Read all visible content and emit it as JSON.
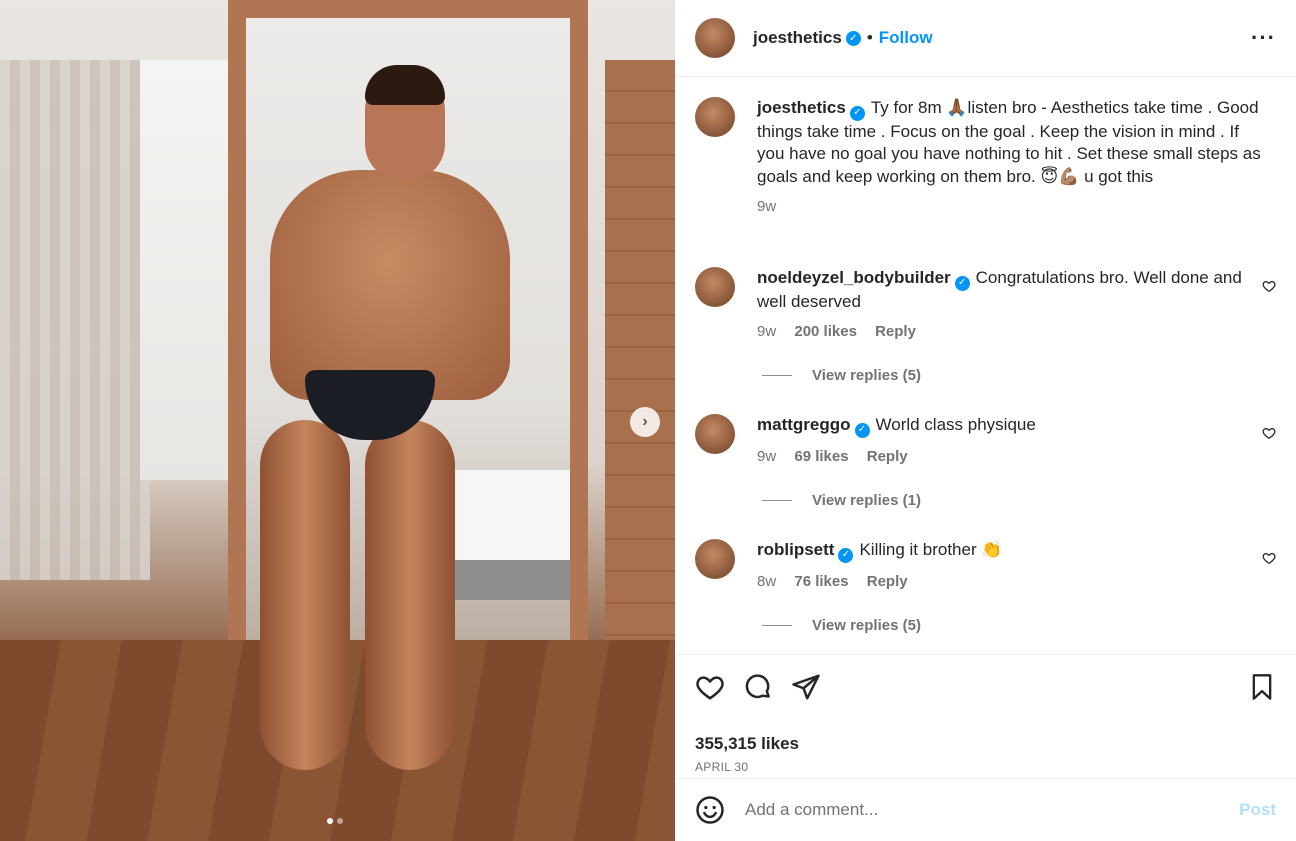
{
  "media": {
    "carousel_next_icon": "chevron-right-icon",
    "dots": [
      true,
      false
    ]
  },
  "post": {
    "username": "joesthetics",
    "follow_label": "Follow",
    "more_icon": "more-horizontal-icon",
    "caption_text": "Ty for 8m 🙏🏾listen bro - Aesthetics take time . Good things take time . Focus on the goal . Keep the vision in mind . If you have no goal you have nothing to hit . Set these small steps as goals and keep working on them bro. 😇💪🏽 u got this",
    "caption_time": "9w",
    "likes": "355,315 likes",
    "date": "APRIL 30",
    "comment_placeholder": "Add a comment...",
    "post_label": "Post"
  },
  "comments": [
    {
      "username": "noeldeyzel_bodybuilder",
      "text": "Congratulations bro. Well done and well deserved",
      "time": "9w",
      "likes": "200 likes",
      "reply": "Reply",
      "view_replies": "View replies (5)"
    },
    {
      "username": "mattgreggo",
      "text": "World class physique",
      "time": "9w",
      "likes": "69 likes",
      "reply": "Reply",
      "view_replies": "View replies (1)"
    },
    {
      "username": "roblipsett",
      "text": "Killing it brother 👏",
      "time": "8w",
      "likes": "76 likes",
      "reply": "Reply",
      "view_replies": "View replies (5)"
    }
  ],
  "colors": {
    "accent": "#0095f6",
    "muted": "#737373",
    "text": "#262626"
  }
}
